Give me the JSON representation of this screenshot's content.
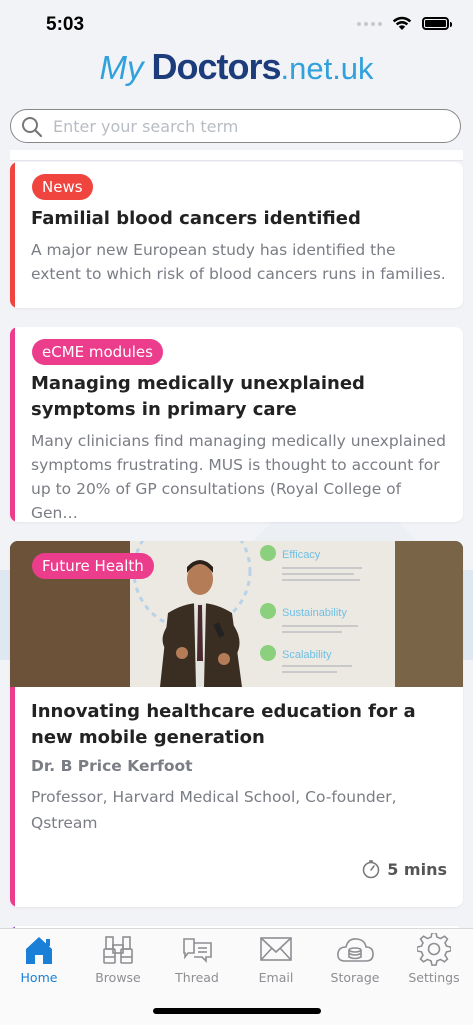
{
  "status": {
    "time": "5:03"
  },
  "logo": {
    "my": "My",
    "doctors": "Doctors",
    "net": ".net.uk"
  },
  "search": {
    "placeholder": "Enter your search term"
  },
  "cards": [
    {
      "badge": "News",
      "badge_color": "#f0453f",
      "title": "Familial blood cancers identified",
      "body": "A major new European study has identified the extent to which risk of blood cancers runs in families."
    },
    {
      "badge": "eCME modules",
      "badge_color": "#ec3d8d",
      "title": "Managing medically unexplained symptoms in primary care",
      "body": "Many clinicians find managing medically unexplained symptoms frustrating. MUS is thought to account for up to 20% of GP consultations (Royal College of Gen…"
    },
    {
      "badge": "Future Health",
      "badge_color": "#ec3d8d",
      "title": "Innovating healthcare education for a new mobile generation",
      "author": "Dr. B Price Kerfoot",
      "role": "Professor, Harvard Medical School, Co-founder, Qstream",
      "duration": "5 mins",
      "slide_text": [
        "Efficacy",
        "Sustainability",
        "Scalability"
      ]
    }
  ],
  "tabs": [
    {
      "label": "Home",
      "icon": "home-icon",
      "active": true
    },
    {
      "label": "Browse",
      "icon": "binoculars-icon",
      "active": false
    },
    {
      "label": "Thread",
      "icon": "chat-icon",
      "active": false
    },
    {
      "label": "Email",
      "icon": "envelope-icon",
      "active": false
    },
    {
      "label": "Storage",
      "icon": "cloud-storage-icon",
      "active": false
    },
    {
      "label": "Settings",
      "icon": "gear-icon",
      "active": false
    }
  ],
  "colors": {
    "accent": "#1a7fd6",
    "brand_dark": "#1d3c7c",
    "brand_light": "#31a1dc"
  }
}
